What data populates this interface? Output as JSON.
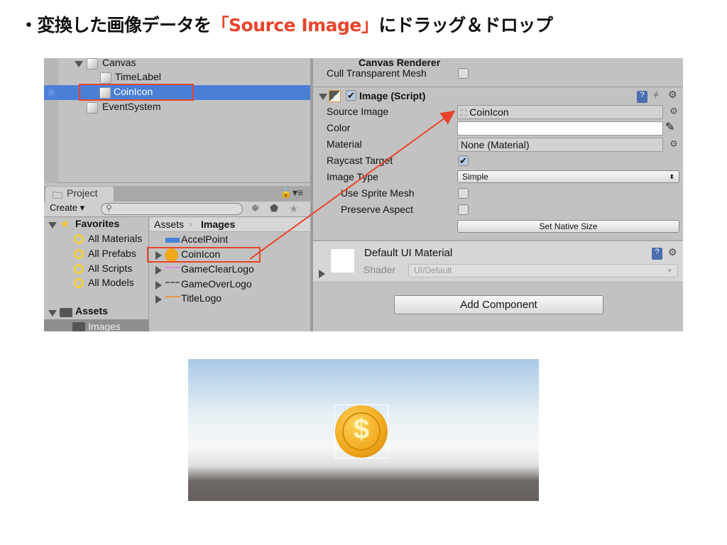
{
  "heading": {
    "bullet": "・",
    "prefix": "変換した画像データを",
    "highlight": "「Source Image」",
    "suffix": "にドラッグ＆ドロップ"
  },
  "hierarchy": {
    "items": [
      {
        "label": "Canvas",
        "expanded": true
      },
      {
        "label": "TimeLabel"
      },
      {
        "label": "CoinIcon",
        "selected": true
      },
      {
        "label": "EventSystem"
      }
    ]
  },
  "project": {
    "tab": "Project",
    "create": "Create",
    "search_placeholder": "",
    "favorites": {
      "label": "Favorites",
      "items": [
        "All Materials",
        "All Prefabs",
        "All Scripts",
        "All Models"
      ]
    },
    "assets": {
      "label": "Assets",
      "items": [
        "Images"
      ]
    },
    "breadcrumb": [
      "Assets",
      "Images"
    ],
    "files": [
      "AccelPoint",
      "CoinIcon",
      "GameClearLogo",
      "GameOverLogo",
      "TitleLogo"
    ]
  },
  "inspector": {
    "canvas_renderer": {
      "title": "Canvas Renderer",
      "cull_label": "Cull Transparent Mesh",
      "cull": false
    },
    "image": {
      "title": "Image (Script)",
      "enabled": true,
      "source_image_label": "Source Image",
      "source_image": "CoinIcon",
      "color_label": "Color",
      "color": "#ffffff",
      "material_label": "Material",
      "material": "None (Material)",
      "raycast_label": "Raycast Target",
      "raycast": true,
      "image_type_label": "Image Type",
      "image_type": "Simple",
      "sprite_mesh_label": "Use Sprite Mesh",
      "sprite_mesh": false,
      "preserve_label": "Preserve Aspect",
      "preserve": false,
      "native_size": "Set Native Size"
    },
    "material": {
      "title": "Default UI Material",
      "shader_label": "Shader",
      "shader": "UI/Default"
    },
    "add_component": "Add Component"
  },
  "game": {
    "coin_symbol": "$"
  },
  "colors": {
    "accent": "#e8452c",
    "selection": "#4a7fd8",
    "coin": "#f0a81c"
  }
}
